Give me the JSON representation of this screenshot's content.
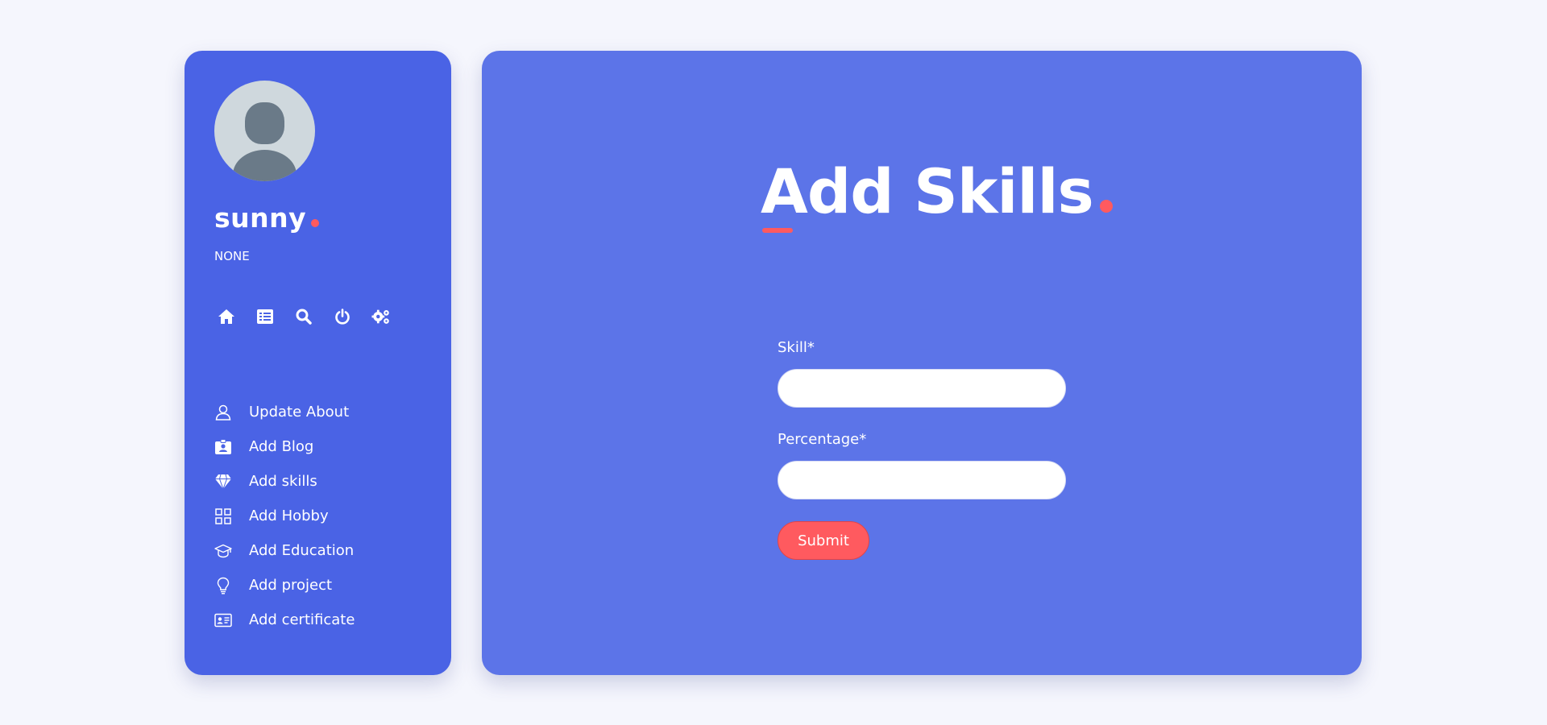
{
  "profile": {
    "name": "sunny",
    "role": "NONE"
  },
  "quick_icons": [
    "home-icon",
    "list-icon",
    "search-icon",
    "power-icon",
    "settings-icon"
  ],
  "menu": [
    {
      "label": "Update About",
      "icon": "user-icon"
    },
    {
      "label": "Add Blog",
      "icon": "id-badge-icon"
    },
    {
      "label": "Add skills",
      "icon": "diamond-icon"
    },
    {
      "label": "Add Hobby",
      "icon": "grid-icon"
    },
    {
      "label": "Add Education",
      "icon": "graduation-cap-icon"
    },
    {
      "label": "Add project",
      "icon": "lightbulb-icon"
    },
    {
      "label": "Add certificate",
      "icon": "id-card-icon"
    }
  ],
  "main": {
    "title": "Add Skills",
    "skill_label": "Skill*",
    "skill_value": "",
    "percentage_label": "Percentage*",
    "percentage_value": "",
    "submit_label": "Submit"
  },
  "colors": {
    "sidebar": "#4a63e5",
    "main": "#5c74e8",
    "accent": "#ff5a5f",
    "background": "#f5f6fd"
  }
}
